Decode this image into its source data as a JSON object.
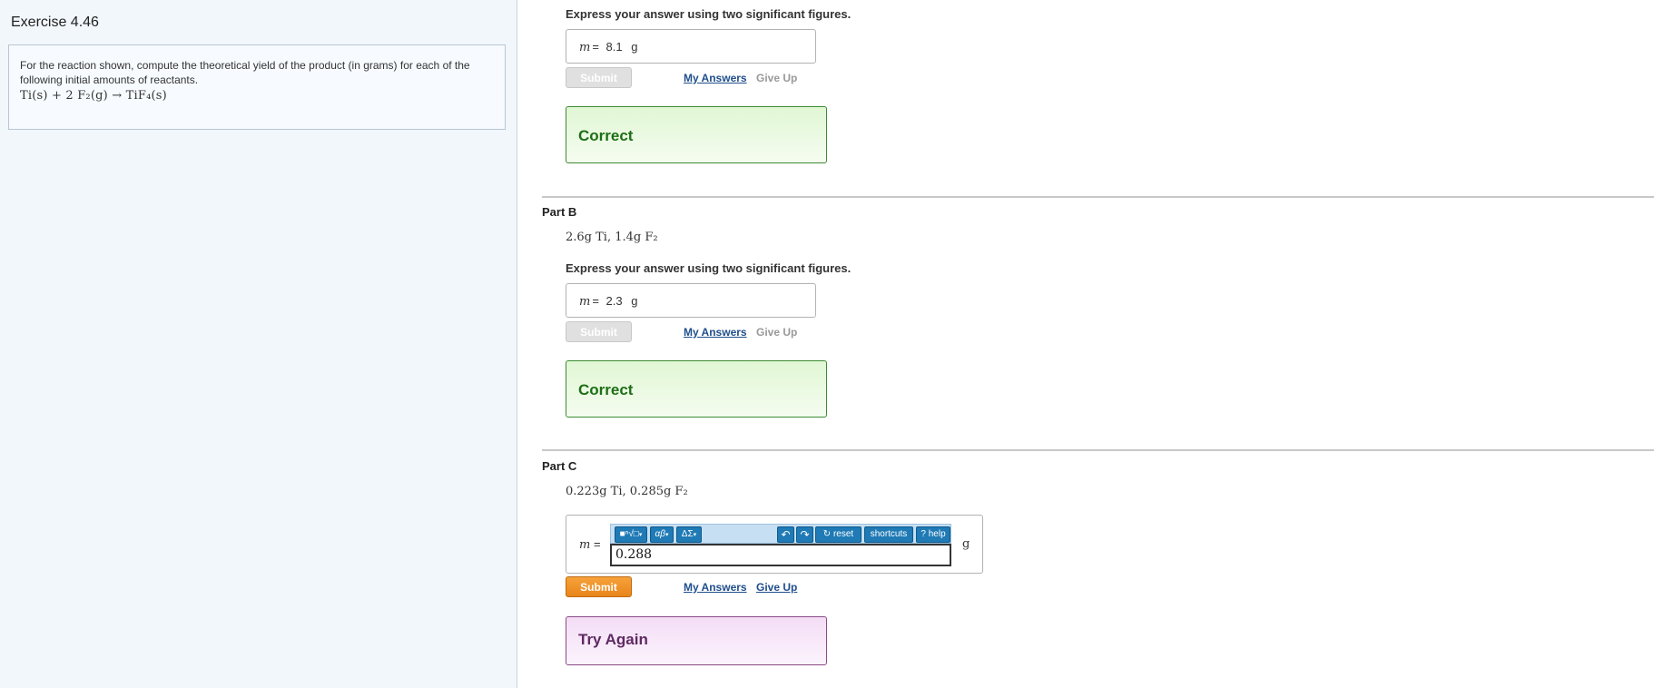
{
  "left": {
    "exercise_title": "Exercise 4.46",
    "problem_text": "For the reaction shown, compute the theoretical yield of the product (in grams) for each of the following initial amounts of reactants.",
    "reaction": "Ti(s) + 2 F₂(g) → TiF₄(s)"
  },
  "part_a": {
    "instruction": "Express your answer using two significant figures.",
    "variable": "m",
    "equals": "=",
    "answer": "8.1",
    "unit": "g",
    "submit_label": "Submit",
    "my_answers_label": "My Answers",
    "give_up_label": "Give Up",
    "feedback": "Correct"
  },
  "part_b": {
    "label": "Part B",
    "prompt": "2.6g Ti, 1.4g F₂",
    "instruction": "Express your answer using two significant figures.",
    "variable": "m",
    "equals": "=",
    "answer": "2.3",
    "unit": "g",
    "submit_label": "Submit",
    "my_answers_label": "My Answers",
    "give_up_label": "Give Up",
    "feedback": "Correct"
  },
  "part_c": {
    "label": "Part C",
    "prompt": "0.223g Ti, 0.285g F₂",
    "variable": "m",
    "equals": "=",
    "input_value": "0.288",
    "unit": "g",
    "toolbar": {
      "templates_label": "■ⁿ√□",
      "greek_label": "αβ",
      "symbols_label": "ΔΣ",
      "undo_icon": "undo-icon",
      "redo_icon": "redo-icon",
      "reset_label": "reset",
      "shortcuts_label": "shortcuts",
      "help_label": "help"
    },
    "submit_label": "Submit",
    "my_answers_label": "My Answers",
    "give_up_label": "Give Up",
    "feedback": "Try Again"
  },
  "colors": {
    "correct_border": "#3b8b32",
    "try_again_border": "#8a4a86",
    "submit_active": "#e8851a",
    "link": "#1f4e8c"
  }
}
